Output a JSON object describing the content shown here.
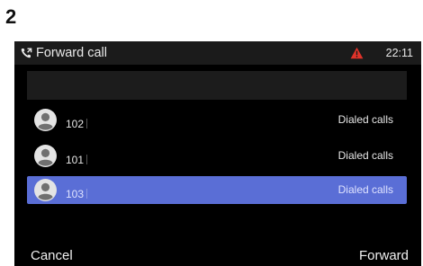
{
  "step_number": "2",
  "status_bar": {
    "title_icon": "forward-call-icon",
    "title": "Forward call",
    "alert_icon": "warning-icon",
    "alert_color": "#e0332a",
    "time": "22:11"
  },
  "input": {
    "value": "",
    "placeholder": ""
  },
  "list": {
    "items": [
      {
        "number": "102",
        "type": "Dialed calls",
        "selected": false,
        "icon": "contact-avatar-icon"
      },
      {
        "number": "101",
        "type": "Dialed calls",
        "selected": false,
        "icon": "contact-avatar-icon"
      },
      {
        "number": "103",
        "type": "Dialed calls",
        "selected": true,
        "icon": "contact-avatar-icon"
      }
    ],
    "selection_color": "#5a6ed6"
  },
  "softkeys": {
    "left": "Cancel",
    "right": "Forward"
  }
}
